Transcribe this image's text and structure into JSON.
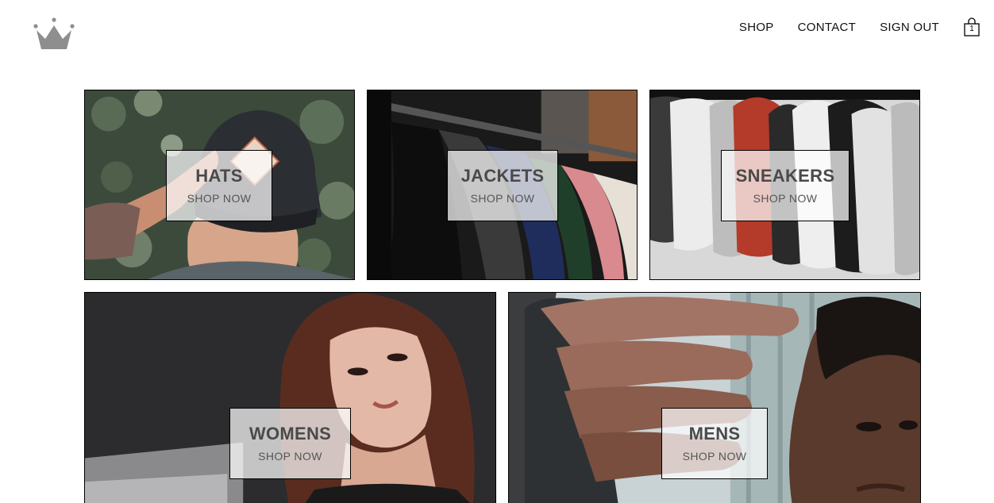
{
  "header": {
    "logo_icon": "crown-icon",
    "nav": {
      "shop": "SHOP",
      "contact": "CONTACT",
      "sign_out": "SIGN OUT"
    },
    "cart": {
      "icon": "shopping-bag-icon",
      "count": "1"
    }
  },
  "sections": [
    {
      "title": "HATS",
      "subtitle": "SHOP NOW"
    },
    {
      "title": "JACKETS",
      "subtitle": "SHOP NOW"
    },
    {
      "title": "SNEAKERS",
      "subtitle": "SHOP NOW"
    },
    {
      "title": "WOMENS",
      "subtitle": "SHOP NOW"
    },
    {
      "title": "MENS",
      "subtitle": "SHOP NOW"
    }
  ],
  "colors": {
    "text": "#111111",
    "label_title": "#4a4a4a",
    "label_background": "rgba(255,255,255,0.72)",
    "logo_gray": "#8e8e8e"
  }
}
